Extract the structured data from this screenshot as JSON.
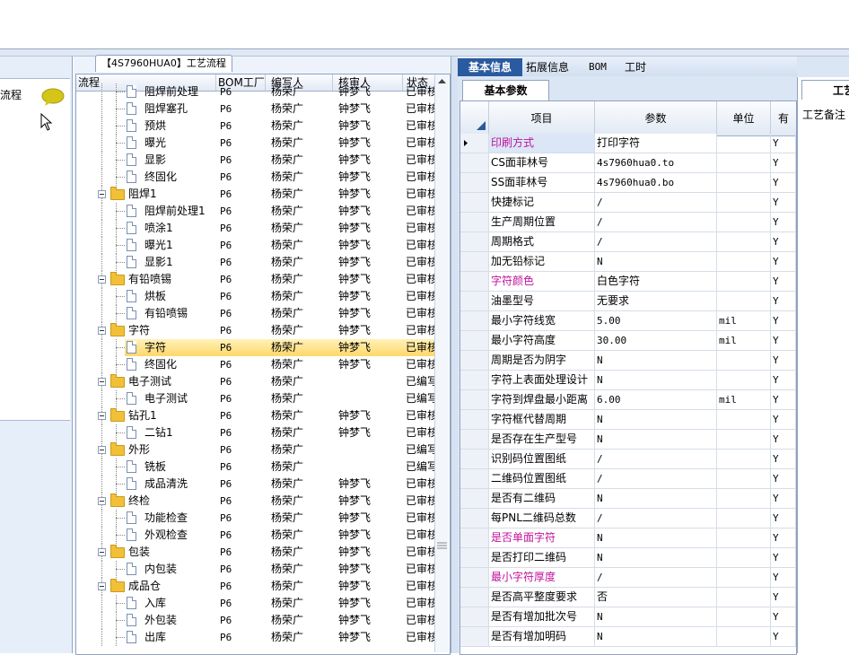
{
  "left_panel": {
    "label": "流程"
  },
  "tree_panel": {
    "tab": "【4S7960HUA0】工艺流程",
    "headers": [
      "流程",
      "BOM工厂",
      "编写人",
      "核审人",
      "状态"
    ],
    "rows": [
      {
        "level": 2,
        "type": "doc",
        "name": "阻焊前处理",
        "bom": "P6",
        "writer": "杨荣广",
        "reviewer": "钟梦飞",
        "status": "已审核"
      },
      {
        "level": 2,
        "type": "doc",
        "name": "阻焊塞孔",
        "bom": "P6",
        "writer": "杨荣广",
        "reviewer": "钟梦飞",
        "status": "已审核"
      },
      {
        "level": 2,
        "type": "doc",
        "name": "预烘",
        "bom": "P6",
        "writer": "杨荣广",
        "reviewer": "钟梦飞",
        "status": "已审核"
      },
      {
        "level": 2,
        "type": "doc",
        "name": "曝光",
        "bom": "P6",
        "writer": "杨荣广",
        "reviewer": "钟梦飞",
        "status": "已审核"
      },
      {
        "level": 2,
        "type": "doc",
        "name": "显影",
        "bom": "P6",
        "writer": "杨荣广",
        "reviewer": "钟梦飞",
        "status": "已审核"
      },
      {
        "level": 2,
        "type": "doc",
        "name": "终固化",
        "bom": "P6",
        "writer": "杨荣广",
        "reviewer": "钟梦飞",
        "status": "已审核"
      },
      {
        "level": 1,
        "type": "folder",
        "name": "阻焊1",
        "bom": "P6",
        "writer": "杨荣广",
        "reviewer": "钟梦飞",
        "status": "已审核"
      },
      {
        "level": 2,
        "type": "doc",
        "name": "阻焊前处理1",
        "bom": "P6",
        "writer": "杨荣广",
        "reviewer": "钟梦飞",
        "status": "已审核"
      },
      {
        "level": 2,
        "type": "doc",
        "name": "喷涂1",
        "bom": "P6",
        "writer": "杨荣广",
        "reviewer": "钟梦飞",
        "status": "已审核"
      },
      {
        "level": 2,
        "type": "doc",
        "name": "曝光1",
        "bom": "P6",
        "writer": "杨荣广",
        "reviewer": "钟梦飞",
        "status": "已审核"
      },
      {
        "level": 2,
        "type": "doc",
        "name": "显影1",
        "bom": "P6",
        "writer": "杨荣广",
        "reviewer": "钟梦飞",
        "status": "已审核"
      },
      {
        "level": 1,
        "type": "folder",
        "name": "有铅喷锡",
        "bom": "P6",
        "writer": "杨荣广",
        "reviewer": "钟梦飞",
        "status": "已审核"
      },
      {
        "level": 2,
        "type": "doc",
        "name": "烘板",
        "bom": "P6",
        "writer": "杨荣广",
        "reviewer": "钟梦飞",
        "status": "已审核"
      },
      {
        "level": 2,
        "type": "doc",
        "name": "有铅喷锡",
        "bom": "P6",
        "writer": "杨荣广",
        "reviewer": "钟梦飞",
        "status": "已审核"
      },
      {
        "level": 1,
        "type": "folder",
        "name": "字符",
        "bom": "P6",
        "writer": "杨荣广",
        "reviewer": "钟梦飞",
        "status": "已审核"
      },
      {
        "level": 2,
        "type": "doc",
        "name": "字符",
        "bom": "P6",
        "writer": "杨荣广",
        "reviewer": "钟梦飞",
        "status": "已审核",
        "selected": true
      },
      {
        "level": 2,
        "type": "doc",
        "name": "终固化",
        "bom": "P6",
        "writer": "杨荣广",
        "reviewer": "钟梦飞",
        "status": "已审核"
      },
      {
        "level": 1,
        "type": "folder",
        "name": "电子测试",
        "bom": "P6",
        "writer": "杨荣广",
        "reviewer": "",
        "status": "已编写"
      },
      {
        "level": 2,
        "type": "doc",
        "name": "电子测试",
        "bom": "P6",
        "writer": "杨荣广",
        "reviewer": "",
        "status": "已编写"
      },
      {
        "level": 1,
        "type": "folder",
        "name": "钻孔1",
        "bom": "P6",
        "writer": "杨荣广",
        "reviewer": "钟梦飞",
        "status": "已审核"
      },
      {
        "level": 2,
        "type": "doc",
        "name": "二钻1",
        "bom": "P6",
        "writer": "杨荣广",
        "reviewer": "钟梦飞",
        "status": "已审核"
      },
      {
        "level": 1,
        "type": "folder",
        "name": "外形",
        "bom": "P6",
        "writer": "杨荣广",
        "reviewer": "",
        "status": "已编写"
      },
      {
        "level": 2,
        "type": "doc",
        "name": "铣板",
        "bom": "P6",
        "writer": "杨荣广",
        "reviewer": "",
        "status": "已编写"
      },
      {
        "level": 2,
        "type": "doc",
        "name": "成品清洗",
        "bom": "P6",
        "writer": "杨荣广",
        "reviewer": "钟梦飞",
        "status": "已审核"
      },
      {
        "level": 1,
        "type": "folder",
        "name": "终检",
        "bom": "P6",
        "writer": "杨荣广",
        "reviewer": "钟梦飞",
        "status": "已审核"
      },
      {
        "level": 2,
        "type": "doc",
        "name": "功能检查",
        "bom": "P6",
        "writer": "杨荣广",
        "reviewer": "钟梦飞",
        "status": "已审核"
      },
      {
        "level": 2,
        "type": "doc",
        "name": "外观检查",
        "bom": "P6",
        "writer": "杨荣广",
        "reviewer": "钟梦飞",
        "status": "已审核"
      },
      {
        "level": 1,
        "type": "folder",
        "name": "包装",
        "bom": "P6",
        "writer": "杨荣广",
        "reviewer": "钟梦飞",
        "status": "已审核"
      },
      {
        "level": 2,
        "type": "doc",
        "name": "内包装",
        "bom": "P6",
        "writer": "杨荣广",
        "reviewer": "钟梦飞",
        "status": "已审核"
      },
      {
        "level": 1,
        "type": "folder",
        "name": "成品仓",
        "bom": "P6",
        "writer": "杨荣广",
        "reviewer": "钟梦飞",
        "status": "已审核"
      },
      {
        "level": 2,
        "type": "doc",
        "name": "入库",
        "bom": "P6",
        "writer": "杨荣广",
        "reviewer": "钟梦飞",
        "status": "已审核"
      },
      {
        "level": 2,
        "type": "doc",
        "name": "外包装",
        "bom": "P6",
        "writer": "杨荣广",
        "reviewer": "钟梦飞",
        "status": "已审核"
      },
      {
        "level": 2,
        "type": "doc",
        "name": "出库",
        "bom": "P6",
        "writer": "杨荣广",
        "reviewer": "钟梦飞",
        "status": "已审核"
      }
    ]
  },
  "right_panel": {
    "tabs": [
      "基本信息",
      "拓展信息",
      "BOM",
      "工时"
    ],
    "active_tab": 0,
    "subtab": "基本参数",
    "headers": [
      "项目",
      "参数",
      "单位",
      "有"
    ],
    "rows": [
      {
        "item": "印刷方式",
        "param": "打印字符",
        "unit": "",
        "flag": "Y",
        "magenta": true,
        "current": true
      },
      {
        "item": "CS面菲林号",
        "param": "4s7960hua0.to",
        "unit": "",
        "flag": "Y"
      },
      {
        "item": "SS面菲林号",
        "param": "4s7960hua0.bo",
        "unit": "",
        "flag": "Y"
      },
      {
        "item": "快捷标记",
        "param": "/",
        "unit": "",
        "flag": "Y"
      },
      {
        "item": "生产周期位置",
        "param": "/",
        "unit": "",
        "flag": "Y"
      },
      {
        "item": "周期格式",
        "param": "/",
        "unit": "",
        "flag": "Y"
      },
      {
        "item": "加无铅标记",
        "param": "N",
        "unit": "",
        "flag": "Y"
      },
      {
        "item": "字符颜色",
        "param": "白色字符",
        "unit": "",
        "flag": "Y",
        "magenta": true
      },
      {
        "item": "油墨型号",
        "param": "无要求",
        "unit": "",
        "flag": "Y"
      },
      {
        "item": "最小字符线宽",
        "param": "5.00",
        "unit": "mil",
        "flag": "Y"
      },
      {
        "item": "最小字符高度",
        "param": "30.00",
        "unit": "mil",
        "flag": "Y"
      },
      {
        "item": "周期是否为阴字",
        "param": "N",
        "unit": "",
        "flag": "Y"
      },
      {
        "item": "字符上表面处理设计",
        "param": "N",
        "unit": "",
        "flag": "Y"
      },
      {
        "item": "字符到焊盘最小距离",
        "param": "6.00",
        "unit": "mil",
        "flag": "Y"
      },
      {
        "item": "字符框代替周期",
        "param": "N",
        "unit": "",
        "flag": "Y"
      },
      {
        "item": "是否存在生产型号",
        "param": "N",
        "unit": "",
        "flag": "Y"
      },
      {
        "item": "识别码位置图纸",
        "param": "/",
        "unit": "",
        "flag": "Y"
      },
      {
        "item": "二维码位置图纸",
        "param": "/",
        "unit": "",
        "flag": "Y"
      },
      {
        "item": "是否有二维码",
        "param": "N",
        "unit": "",
        "flag": "Y"
      },
      {
        "item": "每PNL二维码总数",
        "param": "/",
        "unit": "",
        "flag": "Y"
      },
      {
        "item": "是否单面字符",
        "param": "N",
        "unit": "",
        "flag": "Y",
        "magenta": true
      },
      {
        "item": "是否打印二维码",
        "param": "N",
        "unit": "",
        "flag": "Y"
      },
      {
        "item": "最小字符厚度",
        "param": "/",
        "unit": "",
        "flag": "Y",
        "magenta": true
      },
      {
        "item": "是否高平整度要求",
        "param": "否",
        "unit": "",
        "flag": "Y"
      },
      {
        "item": "是否有增加批次号",
        "param": "N",
        "unit": "",
        "flag": "Y"
      },
      {
        "item": "是否有增加明码",
        "param": "N",
        "unit": "",
        "flag": "Y"
      }
    ]
  },
  "far_right": {
    "tab": "工艺",
    "label": "工艺备注"
  },
  "colors": {
    "accent": "#2a5aa0",
    "magenta": "#c0129a",
    "selection": "#ffd86a"
  }
}
